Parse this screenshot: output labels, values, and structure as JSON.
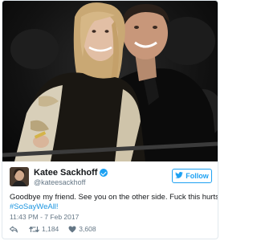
{
  "tweet": {
    "author_name": "Katee Sackhoff",
    "author_handle": "@kateesackhoff",
    "follow_label": "Follow",
    "text": "Goodbye my friend. See you on the other side. Fuck this hurts.",
    "hashtag": "#SoSayWeAll!",
    "timestamp": "11:43 PM - 7 Feb 2017",
    "retweets": "1,184",
    "likes": "3,608"
  },
  "icons": {
    "verified": "verified-badge-icon",
    "follow": "bird-icon",
    "reply": "reply-icon",
    "retweet": "retweet-icon",
    "like": "heart-icon"
  },
  "colors": {
    "accent": "#1da1f2",
    "hashtag": "#1b95e0",
    "muted": "#657786",
    "heart": "#e0245e",
    "border": "#e1e8ed"
  }
}
